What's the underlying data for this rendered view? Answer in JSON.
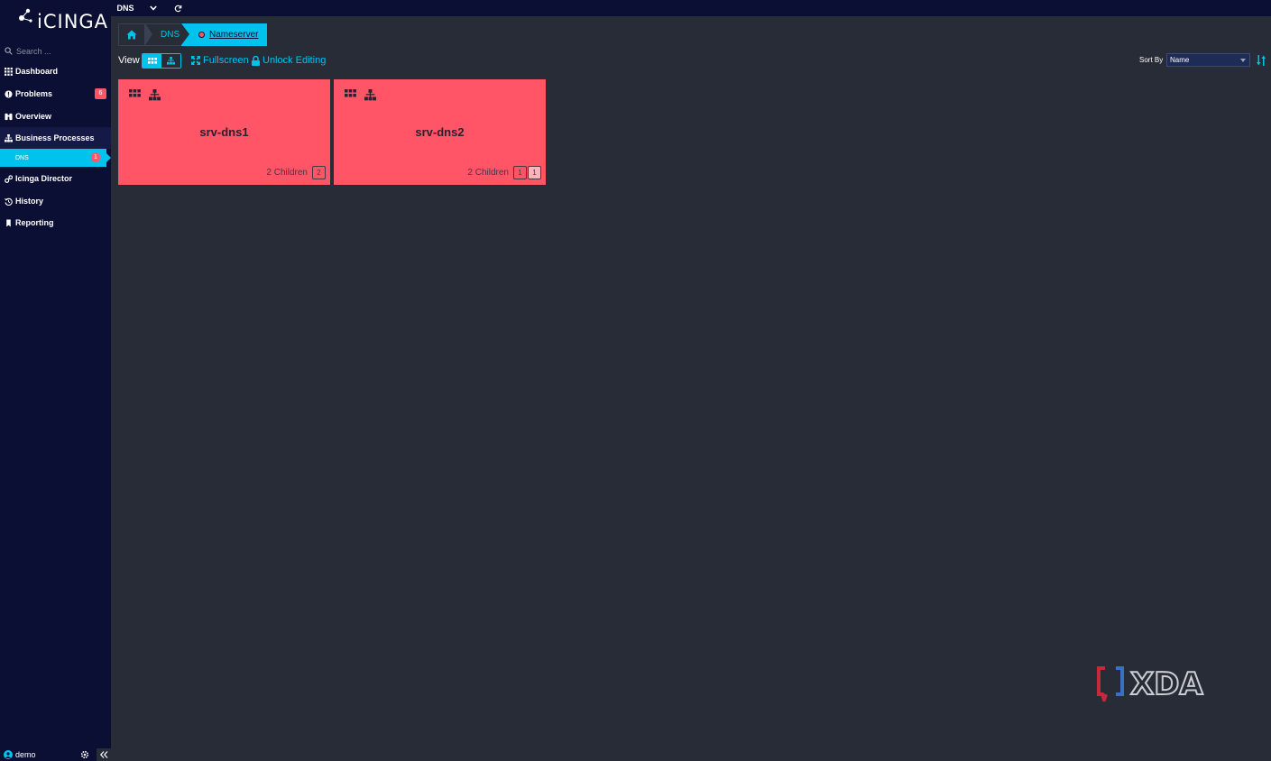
{
  "app": {
    "logo_text": "iCINGA"
  },
  "search": {
    "placeholder": "Search ..."
  },
  "nav": {
    "dashboard": "Dashboard",
    "problems": "Problems",
    "problems_count": "6",
    "overview": "Overview",
    "business_processes": "Business Processes",
    "dns_sub": "DNS",
    "dns_sub_count": "1",
    "director": "Icinga Director",
    "history": "History",
    "reporting": "Reporting"
  },
  "footer": {
    "user": "demo"
  },
  "topbar": {
    "tab": "DNS"
  },
  "breadcrumb": {
    "dns": "DNS",
    "current": "Nameserver"
  },
  "controls": {
    "view_label": "View",
    "fullscreen": "Fullscreen",
    "unlock": "Unlock Editing",
    "sort_by_label": "Sort By",
    "sort_value": "Name"
  },
  "tiles": [
    {
      "name": "srv-dns1",
      "children_label": "2 Children",
      "badges": [
        "2"
      ]
    },
    {
      "name": "srv-dns2",
      "children_label": "2 Children",
      "badges": [
        "1",
        "1"
      ]
    }
  ],
  "watermark": {
    "text": "XDA"
  },
  "colors": {
    "accent": "#00c3ed",
    "critical": "#ff5566",
    "sidebar": "#0a0f33",
    "background": "#282c37"
  }
}
